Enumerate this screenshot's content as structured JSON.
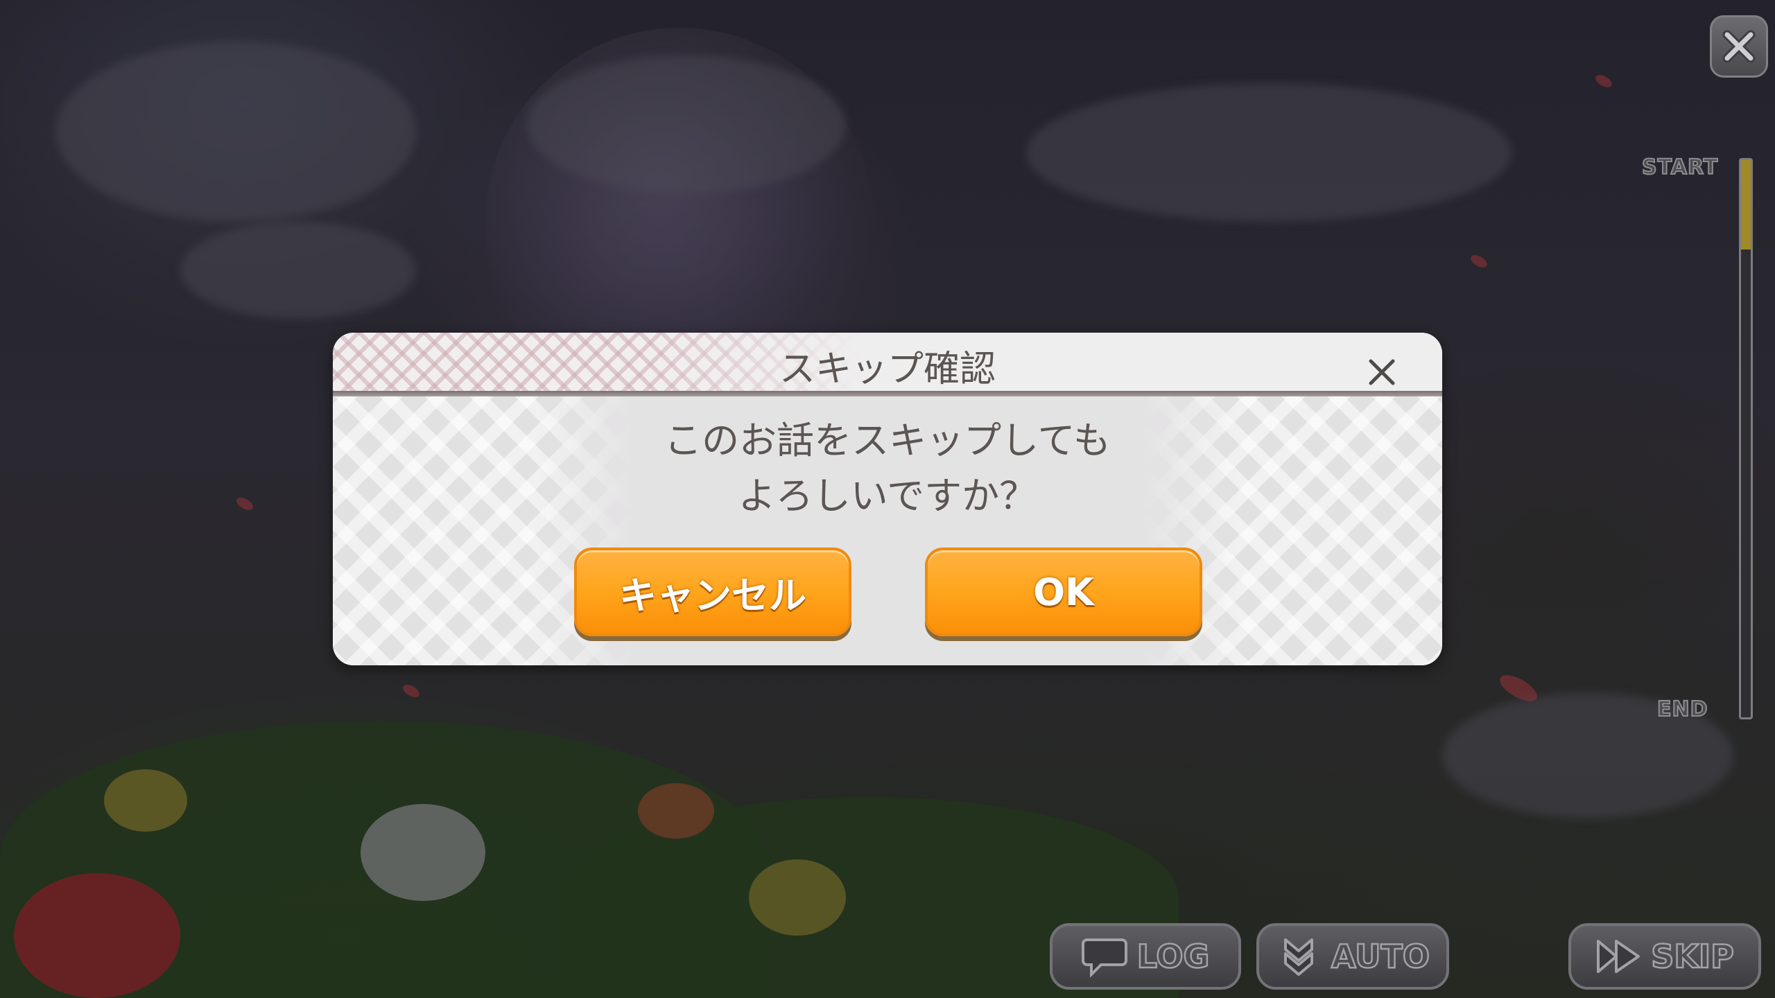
{
  "dialog": {
    "title": "スキップ確認",
    "message_line1": "このお話をスキップしても",
    "message_line2": "よろしいですか？",
    "cancel_label": "キャンセル",
    "ok_label": "OK"
  },
  "progress": {
    "start_label": "START",
    "end_label": "END",
    "fraction": 0.16
  },
  "controls": {
    "log_label": "LOG",
    "auto_label": "AUTO",
    "skip_label": "SKIP"
  },
  "icons": {
    "corner_close": "close-icon",
    "dialog_close": "close-icon",
    "log": "speech-bubble-icon",
    "auto": "double-chevron-down-icon",
    "skip": "fast-forward-icon"
  },
  "colors": {
    "button_orange": "#ffa51c",
    "dialog_bg": "#e3e2e3",
    "progress_fill": "#a08a28"
  }
}
